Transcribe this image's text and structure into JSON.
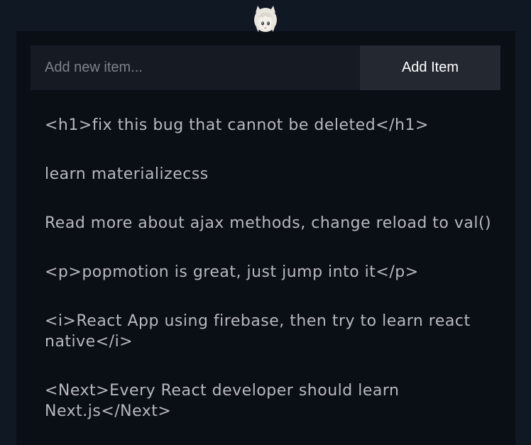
{
  "add_form": {
    "input_placeholder": "Add new item...",
    "input_value": "",
    "button_label": "Add Item"
  },
  "todos": [
    "<h1>fix this bug that cannot be deleted</h1>",
    "learn materializecss",
    "Read more about ajax methods, change reload to val()",
    "<p>popmotion is great, just jump into it</p>",
    "<i>React App using firebase, then try to learn react native</i>",
    "<Next>Every React developer should learn Next.js</Next>"
  ],
  "colors": {
    "background": "#101824",
    "panel": "#0a0e15",
    "input_bg": "#161b23",
    "button_bg": "#232831",
    "item_text": "#b7b9bd"
  },
  "icons": {
    "avatar": "anime-girl-avatar-icon"
  }
}
